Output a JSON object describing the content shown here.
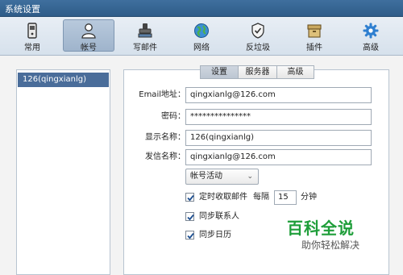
{
  "window": {
    "title": "系统设置"
  },
  "toolbar": {
    "items": [
      {
        "label": "常用",
        "icon": "phone-icon"
      },
      {
        "label": "帐号",
        "icon": "user-icon",
        "active": true
      },
      {
        "label": "写邮件",
        "icon": "stamp-icon"
      },
      {
        "label": "网络",
        "icon": "globe-icon"
      },
      {
        "label": "反垃圾",
        "icon": "shield-icon"
      },
      {
        "label": "插件",
        "icon": "box-icon"
      },
      {
        "label": "高级",
        "icon": "gear-icon"
      }
    ]
  },
  "accounts": {
    "items": [
      {
        "label": "126(qingxianlg)",
        "selected": true
      }
    ]
  },
  "tabs": [
    {
      "label": "设置",
      "active": true
    },
    {
      "label": "服务器"
    },
    {
      "label": "高级"
    }
  ],
  "form": {
    "email": {
      "label": "Email地址：",
      "value": "qingxianlg@126.com"
    },
    "password": {
      "label": "密码：",
      "value": "***************"
    },
    "display_name": {
      "label": "显示名称：",
      "value": "126(qingxianlg)"
    },
    "sender_name": {
      "label": "发信名称：",
      "value": "qingxianlg@126.com"
    },
    "account_status": {
      "value": "帐号活动"
    },
    "schedule": {
      "label": "定时收取邮件",
      "checked": true,
      "interval_label": "每隔",
      "interval_value": "15",
      "unit": "分钟"
    },
    "sync_contacts": {
      "label": "同步联系人",
      "checked": true
    },
    "sync_calendar": {
      "label": "同步日历",
      "checked": true
    }
  },
  "watermark": {
    "main": "百科全说",
    "sub": "助你轻松解决"
  },
  "colors": {
    "titlebar": "#2e5c88",
    "selection": "#4a6d9a",
    "accent_green": "#1f9e3a"
  }
}
